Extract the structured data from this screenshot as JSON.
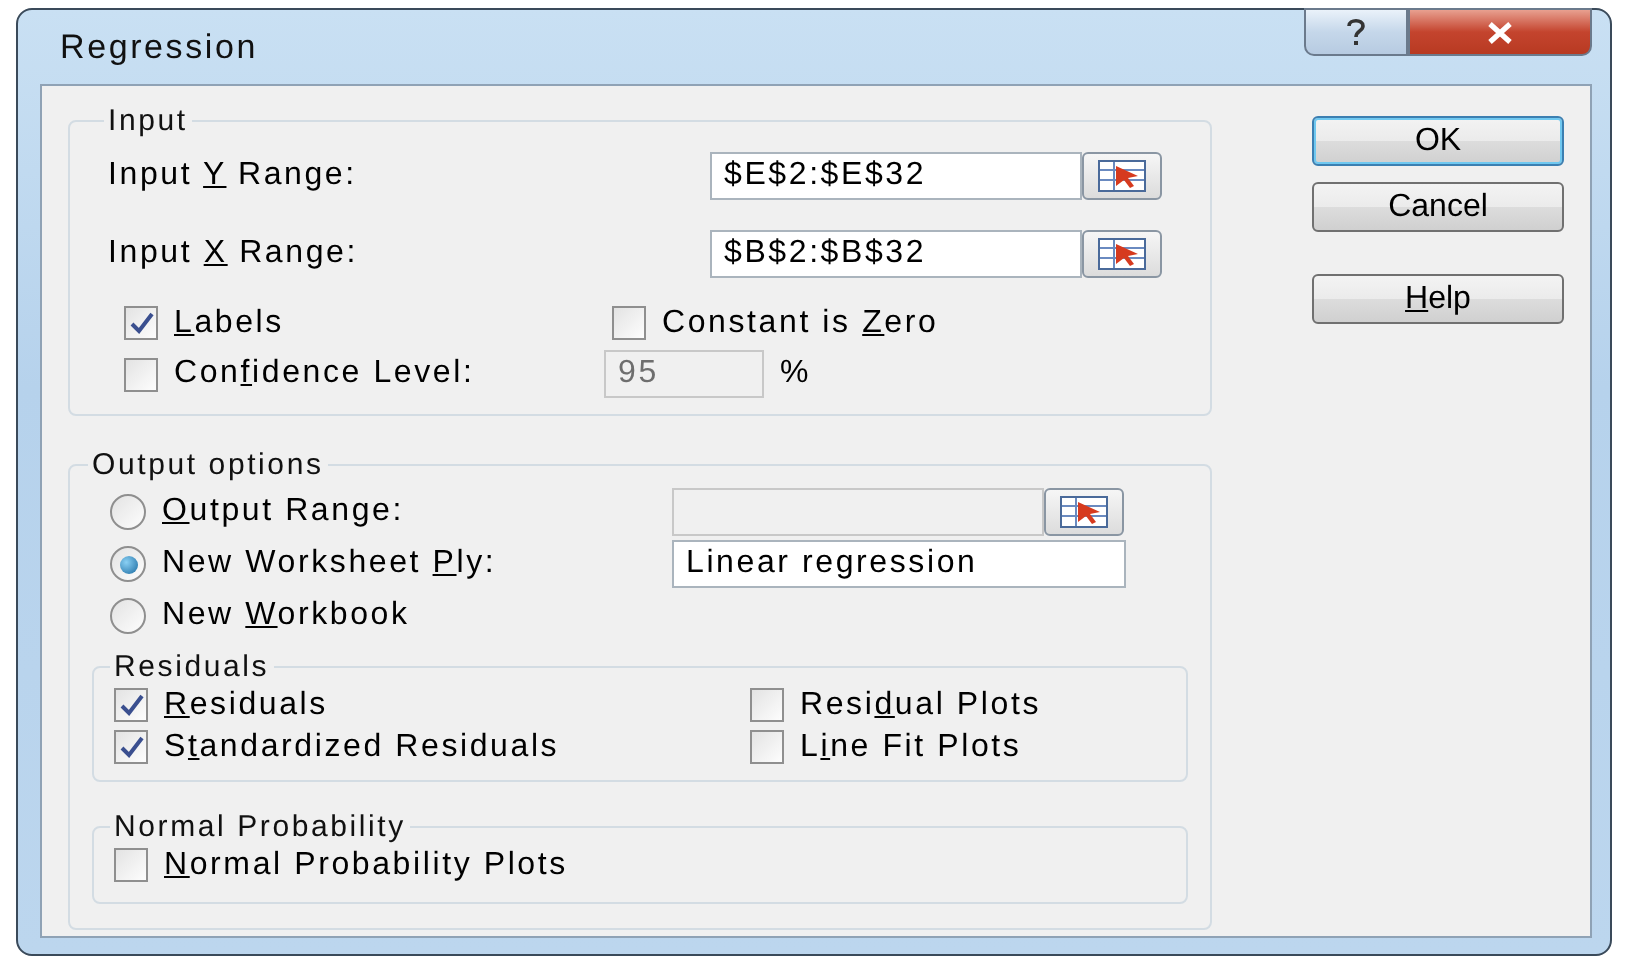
{
  "window": {
    "title": "Regression"
  },
  "input": {
    "legend": "Input",
    "ranges": [
      {
        "label": [
          {
            "text": "Input ",
            "underlined": false
          },
          {
            "text": "Y",
            "underlined": true
          },
          {
            "text": " Range:",
            "underlined": false
          }
        ],
        "value": "$E$2:$E$32"
      },
      {
        "label": [
          {
            "text": "Input ",
            "underlined": false
          },
          {
            "text": "X",
            "underlined": true
          },
          {
            "text": " Range:",
            "underlined": false
          }
        ],
        "value": "$B$2:$B$32"
      }
    ],
    "options": [
      {
        "label": [
          {
            "text": "L",
            "underlined": true
          },
          {
            "text": "abels",
            "underlined": false
          }
        ],
        "checked": true
      },
      {
        "label": [
          {
            "text": "Constant is ",
            "underlined": false
          },
          {
            "text": "Z",
            "underlined": true
          },
          {
            "text": "ero",
            "underlined": false
          }
        ],
        "checked": false
      }
    ],
    "confidence": {
      "label": [
        {
          "text": "Con",
          "underlined": false
        },
        {
          "text": "f",
          "underlined": true
        },
        {
          "text": "idence Level:",
          "underlined": false
        }
      ],
      "checked": false,
      "value": "95",
      "disabled": true,
      "unit": "%"
    }
  },
  "output": {
    "legend": "Output options",
    "destinations": [
      {
        "kind": "range",
        "label": [
          {
            "text": "O",
            "underlined": true
          },
          {
            "text": "utput Range:",
            "underlined": false
          }
        ],
        "selected": false,
        "disabled": true
      },
      {
        "kind": "text",
        "label": [
          {
            "text": "New Worksheet ",
            "underlined": false
          },
          {
            "text": "P",
            "underlined": true
          },
          {
            "text": "ly:",
            "underlined": false
          }
        ],
        "selected": true,
        "value": "Linear regression"
      },
      {
        "kind": "plain",
        "label": [
          {
            "text": "New ",
            "underlined": false
          },
          {
            "text": "W",
            "underlined": true
          },
          {
            "text": "orkbook",
            "underlined": false
          }
        ],
        "selected": false
      }
    ],
    "residuals": {
      "legend": "Residuals",
      "options": [
        {
          "label": [
            {
              "text": "R",
              "underlined": true
            },
            {
              "text": "esiduals",
              "underlined": false
            }
          ],
          "checked": true
        },
        {
          "label": [
            {
              "text": "Resi",
              "underlined": false
            },
            {
              "text": "d",
              "underlined": true
            },
            {
              "text": "ual Plots",
              "underlined": false
            }
          ],
          "checked": false
        },
        {
          "label": [
            {
              "text": "S",
              "underlined": false
            },
            {
              "text": "t",
              "underlined": true
            },
            {
              "text": "andardized Residuals",
              "underlined": false
            }
          ],
          "checked": true
        },
        {
          "label": [
            {
              "text": "L",
              "underlined": false
            },
            {
              "text": "i",
              "underlined": true
            },
            {
              "text": "ne Fit Plots",
              "underlined": false
            }
          ],
          "checked": false
        }
      ]
    },
    "normal_probability": {
      "legend": "Normal Probability",
      "options": [
        {
          "label": [
            {
              "text": "N",
              "underlined": true
            },
            {
              "text": "ormal Probability Plots",
              "underlined": false
            }
          ],
          "checked": false
        }
      ]
    }
  },
  "buttons": [
    {
      "label": [
        {
          "text": "OK",
          "underlined": false
        }
      ],
      "default": true
    },
    {
      "label": [
        {
          "text": "Cancel",
          "underlined": false
        }
      ],
      "default": false
    },
    {
      "label": [
        {
          "text": "H",
          "underlined": true
        },
        {
          "text": "elp",
          "underlined": false
        }
      ],
      "default": false
    }
  ]
}
